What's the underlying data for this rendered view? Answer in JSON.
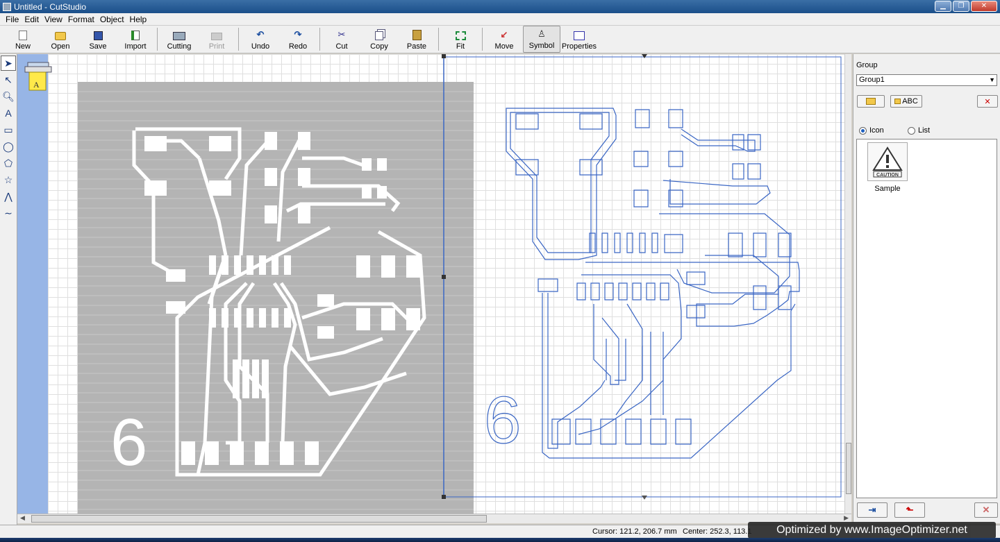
{
  "window": {
    "title": "Untitled - CutStudio"
  },
  "menu": [
    "File",
    "Edit",
    "View",
    "Format",
    "Object",
    "Help"
  ],
  "toolbar": {
    "new": "New",
    "open": "Open",
    "save": "Save",
    "import": "Import",
    "cutting": "Cutting",
    "print": "Print",
    "undo": "Undo",
    "redo": "Redo",
    "cut": "Cut",
    "copy": "Copy",
    "paste": "Paste",
    "fit": "Fit",
    "move": "Move",
    "symbol": "Symbol",
    "properties": "Properties"
  },
  "canvas": {
    "left_label": "6",
    "right_label": "6"
  },
  "panel": {
    "group_label": "Group",
    "group_value": "Group1",
    "abc_button": "ABC",
    "view_icon": "Icon",
    "view_list": "List",
    "sample_caption": "Sample",
    "sample_sign": "CAUTION"
  },
  "status": {
    "cursor": "Cursor: 121.2, 206.7 mm",
    "center": "Center: 252.3, 113.1"
  },
  "watermark": "Optimized by www.ImageOptimizer.net",
  "colors": {
    "trace_blue": "#3a66c4",
    "board_gray": "#b4b4b4",
    "canvas_ruler": "#97b5e6"
  }
}
